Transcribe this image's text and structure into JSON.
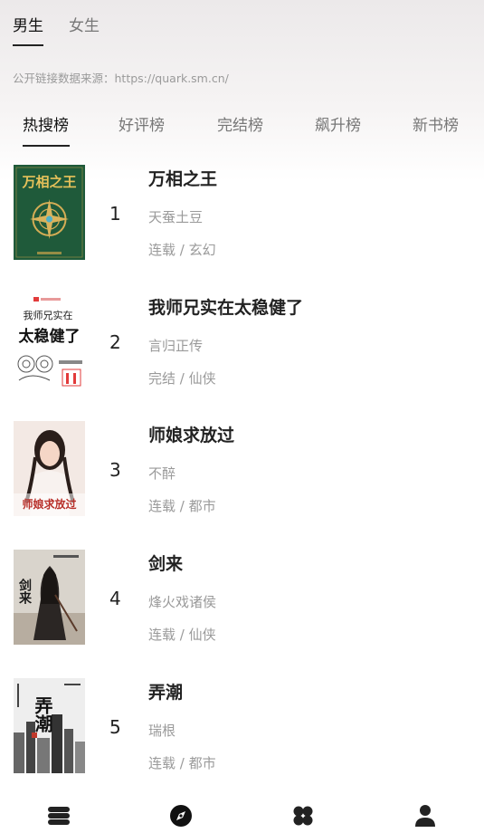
{
  "gender_tabs": [
    {
      "label": "男生",
      "active": true
    },
    {
      "label": "女生",
      "active": false
    }
  ],
  "source_note": "公开链接数据来源：https://quark.sm.cn/",
  "rank_tabs": [
    {
      "label": "热搜榜",
      "active": true
    },
    {
      "label": "好评榜",
      "active": false
    },
    {
      "label": "完结榜",
      "active": false
    },
    {
      "label": "飙升榜",
      "active": false
    },
    {
      "label": "新书榜",
      "active": false
    }
  ],
  "books": [
    {
      "rank": "1",
      "title": "万相之王",
      "author": "天蚕土豆",
      "meta": "连载 / 玄幻",
      "cover_text": "万相之王"
    },
    {
      "rank": "2",
      "title": "我师兄实在太稳健了",
      "author": "言归正传",
      "meta": "完结 / 仙侠",
      "cover_text_top": "我师兄实在",
      "cover_text_big": "太稳健了"
    },
    {
      "rank": "3",
      "title": "师娘求放过",
      "author": "不醉",
      "meta": "连载 / 都市",
      "cover_text": "师娘求放过"
    },
    {
      "rank": "4",
      "title": "剑来",
      "author": "烽火戏诸侯",
      "meta": "连载 / 仙侠",
      "cover_text": "剑来"
    },
    {
      "rank": "5",
      "title": "弄潮",
      "author": "瑞根",
      "meta": "连载 / 都市",
      "cover_text": "弄潮"
    }
  ],
  "bottom_nav": [
    {
      "icon": "bookshelf-icon",
      "active": false
    },
    {
      "icon": "compass-icon",
      "active": true
    },
    {
      "icon": "categories-icon",
      "active": false
    },
    {
      "icon": "user-icon",
      "active": false
    }
  ]
}
